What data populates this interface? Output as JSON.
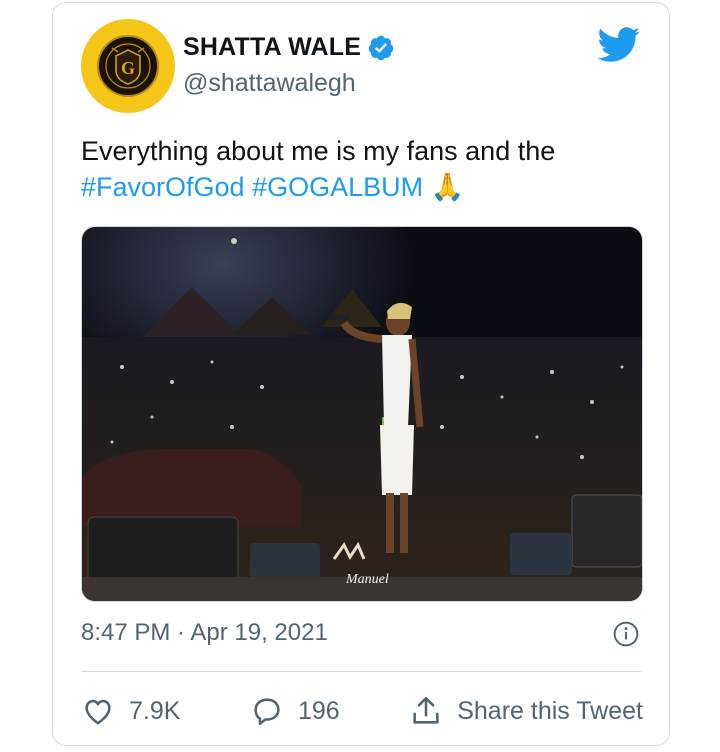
{
  "author": {
    "name": "SHATTA WALE",
    "handle": "@shattawalegh",
    "avatar_color": "#f5c518"
  },
  "tweet": {
    "text": "Everything about me is my fans and the",
    "hashtags": [
      "#FavorOfGod",
      "#GOGALBUM"
    ],
    "emoji": "🙏",
    "timestamp": "8:47 PM · Apr 19, 2021"
  },
  "photo": {
    "watermark": "Manuel"
  },
  "actions": {
    "likes": "7.9K",
    "replies": "196",
    "share_label": "Share this Tweet"
  },
  "colors": {
    "accent": "#1d9bf0",
    "muted": "#536471",
    "border": "#cfd9de"
  },
  "icons": [
    "verified-badge-icon",
    "twitter-bird-icon",
    "info-icon",
    "heart-icon",
    "reply-bubble-icon",
    "share-icon"
  ]
}
